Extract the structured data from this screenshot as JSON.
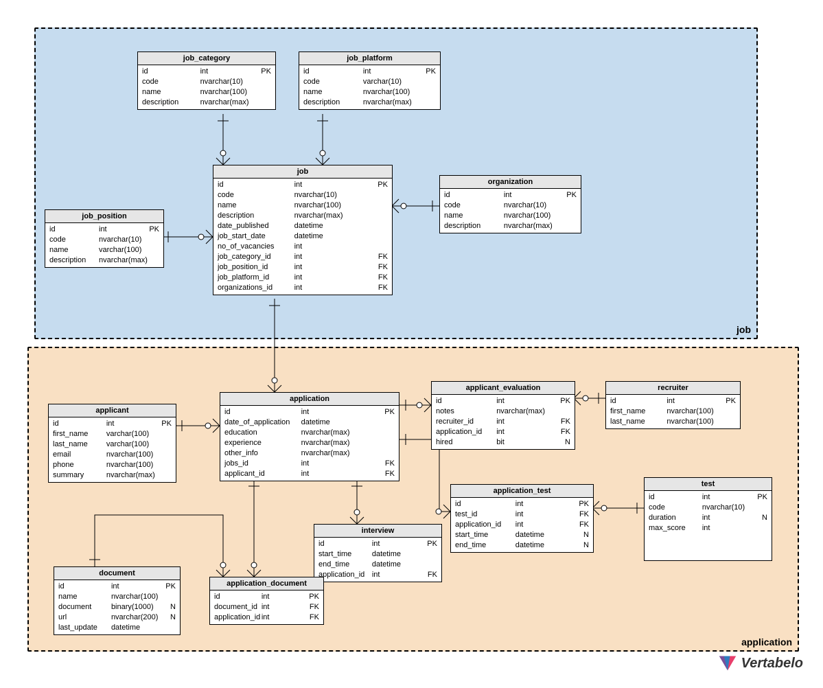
{
  "regions": {
    "job": {
      "label": "job"
    },
    "application": {
      "label": "application"
    }
  },
  "logo_text": "Vertabelo",
  "entities": {
    "job_category": {
      "title": "job_category",
      "rows": [
        {
          "name": "id",
          "type": "int",
          "key": "PK"
        },
        {
          "name": "code",
          "type": "nvarchar(10)",
          "key": ""
        },
        {
          "name": "name",
          "type": "nvarchar(100)",
          "key": ""
        },
        {
          "name": "description",
          "type": "nvarchar(max)",
          "key": ""
        }
      ]
    },
    "job_platform": {
      "title": "job_platform",
      "rows": [
        {
          "name": "id",
          "type": "int",
          "key": "PK"
        },
        {
          "name": "code",
          "type": "varchar(10)",
          "key": ""
        },
        {
          "name": "name",
          "type": "nvarchar(100)",
          "key": ""
        },
        {
          "name": "description",
          "type": "nvarchar(max)",
          "key": ""
        }
      ]
    },
    "job": {
      "title": "job",
      "rows": [
        {
          "name": "id",
          "type": "int",
          "key": "PK"
        },
        {
          "name": "code",
          "type": "nvarchar(10)",
          "key": ""
        },
        {
          "name": "name",
          "type": "nvarchar(100)",
          "key": ""
        },
        {
          "name": "description",
          "type": "nvarchar(max)",
          "key": ""
        },
        {
          "name": "date_published",
          "type": "datetime",
          "key": ""
        },
        {
          "name": "job_start_date",
          "type": "datetime",
          "key": ""
        },
        {
          "name": "no_of_vacancies",
          "type": "int",
          "key": ""
        },
        {
          "name": "job_category_id",
          "type": "int",
          "key": "FK"
        },
        {
          "name": "job_position_id",
          "type": "int",
          "key": "FK"
        },
        {
          "name": "job_platform_id",
          "type": "int",
          "key": "FK"
        },
        {
          "name": "organizations_id",
          "type": "int",
          "key": "FK"
        }
      ]
    },
    "organization": {
      "title": "organization",
      "rows": [
        {
          "name": "id",
          "type": "int",
          "key": "PK"
        },
        {
          "name": "code",
          "type": "nvarchar(10)",
          "key": ""
        },
        {
          "name": "name",
          "type": "nvarchar(100)",
          "key": ""
        },
        {
          "name": "description",
          "type": "nvarchar(max)",
          "key": ""
        }
      ]
    },
    "job_position": {
      "title": "job_position",
      "rows": [
        {
          "name": "id",
          "type": "int",
          "key": "PK"
        },
        {
          "name": "code",
          "type": "nvarchar(10)",
          "key": ""
        },
        {
          "name": "name",
          "type": "varchar(100)",
          "key": ""
        },
        {
          "name": "description",
          "type": "nvarchar(max)",
          "key": ""
        }
      ]
    },
    "applicant": {
      "title": "applicant",
      "rows": [
        {
          "name": "id",
          "type": "int",
          "key": "PK"
        },
        {
          "name": "first_name",
          "type": "varchar(100)",
          "key": ""
        },
        {
          "name": "last_name",
          "type": "varchar(100)",
          "key": ""
        },
        {
          "name": "email",
          "type": "nvarchar(100)",
          "key": ""
        },
        {
          "name": "phone",
          "type": "nvarchar(100)",
          "key": ""
        },
        {
          "name": "summary",
          "type": "nvarchar(max)",
          "key": ""
        }
      ]
    },
    "application": {
      "title": "application",
      "rows": [
        {
          "name": "id",
          "type": "int",
          "key": "PK"
        },
        {
          "name": "date_of_application",
          "type": "datetime",
          "key": ""
        },
        {
          "name": "education",
          "type": "nvarchar(max)",
          "key": ""
        },
        {
          "name": "experience",
          "type": "nvarchar(max)",
          "key": ""
        },
        {
          "name": "other_info",
          "type": "nvarchar(max)",
          "key": ""
        },
        {
          "name": "jobs_id",
          "type": "int",
          "key": "FK"
        },
        {
          "name": "applicant_id",
          "type": "int",
          "key": "FK"
        }
      ]
    },
    "applicant_evaluation": {
      "title": "applicant_evaluation",
      "rows": [
        {
          "name": "id",
          "type": "int",
          "key": "PK"
        },
        {
          "name": "notes",
          "type": "nvarchar(max)",
          "key": ""
        },
        {
          "name": "recruiter_id",
          "type": "int",
          "key": "FK"
        },
        {
          "name": "application_id",
          "type": "int",
          "key": "FK"
        },
        {
          "name": "hired",
          "type": "bit",
          "key": "N"
        }
      ]
    },
    "recruiter": {
      "title": "recruiter",
      "rows": [
        {
          "name": "id",
          "type": "int",
          "key": "PK"
        },
        {
          "name": "first_name",
          "type": "nvarchar(100)",
          "key": ""
        },
        {
          "name": "last_name",
          "type": "nvarchar(100)",
          "key": ""
        }
      ]
    },
    "application_test": {
      "title": "application_test",
      "rows": [
        {
          "name": "id",
          "type": "int",
          "key": "PK"
        },
        {
          "name": "test_id",
          "type": "int",
          "key": "FK"
        },
        {
          "name": "application_id",
          "type": "int",
          "key": "FK"
        },
        {
          "name": "start_time",
          "type": "datetime",
          "key": "N"
        },
        {
          "name": "end_time",
          "type": "datetime",
          "key": "N"
        }
      ]
    },
    "test": {
      "title": "test",
      "rows": [
        {
          "name": "id",
          "type": "int",
          "key": "PK"
        },
        {
          "name": "code",
          "type": "nvarchar(10)",
          "key": ""
        },
        {
          "name": "duration",
          "type": "int",
          "key": "N"
        },
        {
          "name": "max_score",
          "type": "int",
          "key": ""
        }
      ]
    },
    "interview": {
      "title": "interview",
      "rows": [
        {
          "name": "id",
          "type": "int",
          "key": "PK"
        },
        {
          "name": "start_time",
          "type": "datetime",
          "key": ""
        },
        {
          "name": "end_time",
          "type": "datetime",
          "key": ""
        },
        {
          "name": "application_id",
          "type": "int",
          "key": "FK"
        }
      ]
    },
    "document": {
      "title": "document",
      "rows": [
        {
          "name": "id",
          "type": "int",
          "key": "PK"
        },
        {
          "name": "name",
          "type": "nvarchar(100)",
          "key": ""
        },
        {
          "name": "document",
          "type": "binary(1000)",
          "key": "N"
        },
        {
          "name": "url",
          "type": "nvarchar(200)",
          "key": "N"
        },
        {
          "name": "last_update",
          "type": "datetime",
          "key": ""
        }
      ]
    },
    "application_document": {
      "title": "application_document",
      "rows": [
        {
          "name": "id",
          "type": "int",
          "key": "PK"
        },
        {
          "name": "document_id",
          "type": "int",
          "key": "FK"
        },
        {
          "name": "application_id",
          "type": "int",
          "key": "FK"
        }
      ]
    }
  },
  "chart_data": {
    "type": "erd",
    "regions": [
      "job",
      "application"
    ],
    "relationships": [
      {
        "from": "job_category",
        "to": "job",
        "cardinality": "1-to-many"
      },
      {
        "from": "job_platform",
        "to": "job",
        "cardinality": "1-to-many"
      },
      {
        "from": "job_position",
        "to": "job",
        "cardinality": "1-to-many"
      },
      {
        "from": "organization",
        "to": "job",
        "cardinality": "1-to-many"
      },
      {
        "from": "job",
        "to": "application",
        "cardinality": "1-to-many"
      },
      {
        "from": "applicant",
        "to": "application",
        "cardinality": "1-to-many"
      },
      {
        "from": "application",
        "to": "applicant_evaluation",
        "cardinality": "1-to-many"
      },
      {
        "from": "recruiter",
        "to": "applicant_evaluation",
        "cardinality": "1-to-many"
      },
      {
        "from": "application",
        "to": "application_test",
        "cardinality": "1-to-many"
      },
      {
        "from": "test",
        "to": "application_test",
        "cardinality": "1-to-many"
      },
      {
        "from": "application",
        "to": "interview",
        "cardinality": "1-to-many"
      },
      {
        "from": "application",
        "to": "application_document",
        "cardinality": "1-to-many"
      },
      {
        "from": "document",
        "to": "application_document",
        "cardinality": "1-to-many"
      }
    ]
  }
}
